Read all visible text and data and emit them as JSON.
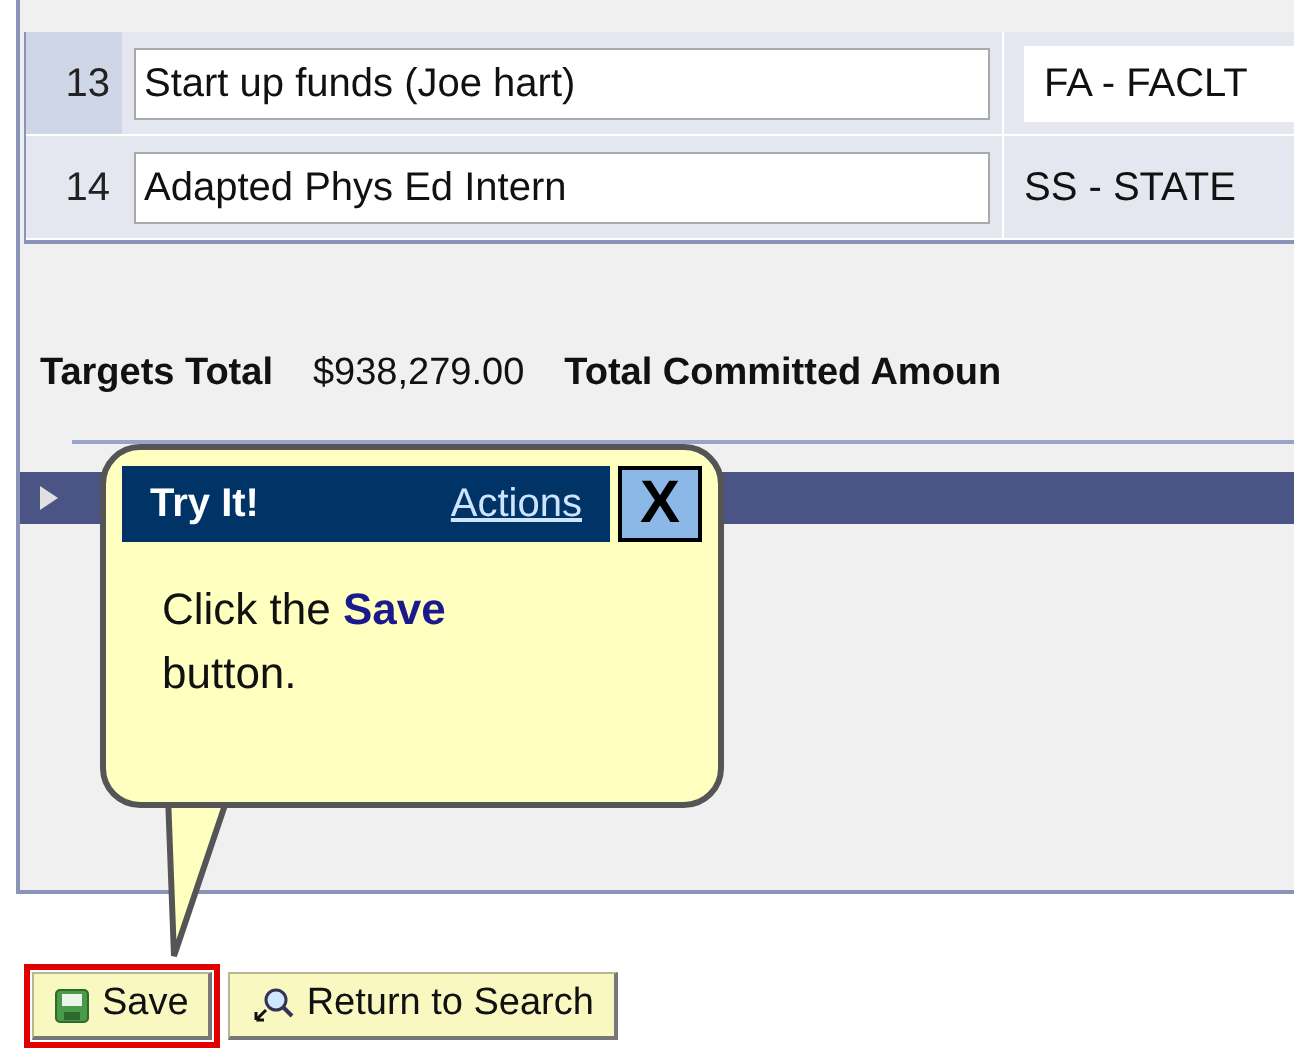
{
  "rows": [
    {
      "number": "13",
      "description": "Start up funds (Joe hart)",
      "code": "FA - FACLT",
      "kind": "field",
      "selected": true
    },
    {
      "number": "14",
      "description": "Adapted Phys Ed Intern",
      "code": "SS - STATE",
      "kind": "text",
      "selected": false
    }
  ],
  "totals": {
    "label": "Targets Total",
    "value": "$938,279.00",
    "committed_label": "Total Committed Amoun"
  },
  "callout": {
    "title": "Try It!",
    "link": "Actions",
    "close": "X",
    "message": "Click the **Save** button."
  },
  "buttons": [
    {
      "label": "Save",
      "kind": "save",
      "highlighted": true
    },
    {
      "label": "Return to Search",
      "kind": "search",
      "highlighted": false
    }
  ]
}
